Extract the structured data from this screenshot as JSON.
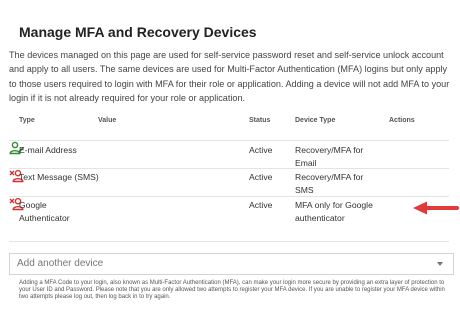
{
  "page": {
    "title": "Manage MFA and Recovery Devices",
    "intro": "The devices managed on this page are used for self-service password reset and self-service unlock account and apply to all users. The same devices are used for Multi-Factor Authentication (MFA) logins but only apply to those users required to login with MFA for their role or application. Adding a device will not add MFA to your login if it is not already required for your role or application."
  },
  "table": {
    "headers": {
      "type": "Type",
      "value": "Value",
      "status": "Status",
      "device_type": "Device Type",
      "actions": "Actions"
    },
    "rows": [
      {
        "type": "E-mail Address",
        "value": "",
        "status": "Active",
        "device_type": "Recovery/MFA for Email",
        "action_icon": "user-edit-icon",
        "action_color": "#2e8b2e"
      },
      {
        "type": "Text Message (SMS)",
        "value": "",
        "status": "Active",
        "device_type": "Recovery/MFA for SMS",
        "action_icon": "user-remove-icon",
        "action_color": "#d33030"
      },
      {
        "type": "Google Authenticator",
        "value": "",
        "status": "Active",
        "device_type": "MFA only for Google authenticator",
        "action_icon": "user-remove-icon",
        "action_color": "#d33030"
      }
    ]
  },
  "add_device": {
    "label": "Add another device"
  },
  "footnote": "Adding a MFA Code to your login, also known as Multi-Factor Authentication (MFA), can make your login more secure by providing an extra layer of protection to your User ID and Password. Please note that you are only allowed two attempts to register your MFA device. If you are unable to register your MFA device within two attempts please log out, then log back in to try again.",
  "colors": {
    "remove": "#d33030",
    "edit": "#2e8b2e",
    "arrow": "#e03a3a"
  }
}
